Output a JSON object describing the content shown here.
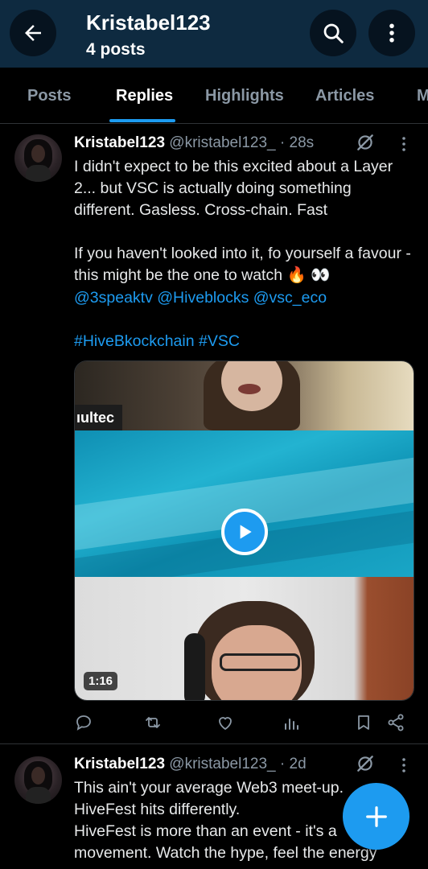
{
  "header": {
    "title": "Kristabel123",
    "subtitle": "4 posts",
    "back_icon": "arrow-left-icon",
    "search_icon": "search-icon",
    "more_icon": "more-vertical-icon"
  },
  "tabs": [
    {
      "label": "Posts",
      "active": false
    },
    {
      "label": "Replies",
      "active": true
    },
    {
      "label": "Highlights",
      "active": false
    },
    {
      "label": "Articles",
      "active": false
    },
    {
      "label": "M",
      "active": false
    }
  ],
  "tweets": [
    {
      "name": "Kristabel123",
      "handle": "@kristabel123_",
      "time": "· 28s",
      "line1": "I didn't expect to be this excited about a Layer 2... but VSC is actually doing something different. Gasless. Cross-chain. Fast",
      "line2": "If you haven't looked into it, fo yourself a favour -this might be the one to watch 🔥 👀",
      "mentions": "@3speaktv @Hiveblocks @vsc_eco",
      "hashtags": "#HiveBkockchain #VSC",
      "media": {
        "name_tag": "ıultec",
        "duration": "1:16",
        "play_icon": "play-icon"
      },
      "actions": [
        "reply-icon",
        "retweet-icon",
        "like-icon",
        "views-icon",
        "bookmark-icon",
        "share-icon"
      ]
    },
    {
      "name": "Kristabel123",
      "handle": "@kristabel123_",
      "time": "· 2d",
      "text": "This ain't your average Web3 meet-up.\nHiveFest hits differently.\nHiveFest is more than an event - it's a movement. Watch the hype, feel the energy"
    }
  ],
  "fab": {
    "icon": "plus-icon"
  },
  "colors": {
    "accent": "#1d9bf0",
    "header_bg": "#0e2a40",
    "background": "#000000"
  }
}
